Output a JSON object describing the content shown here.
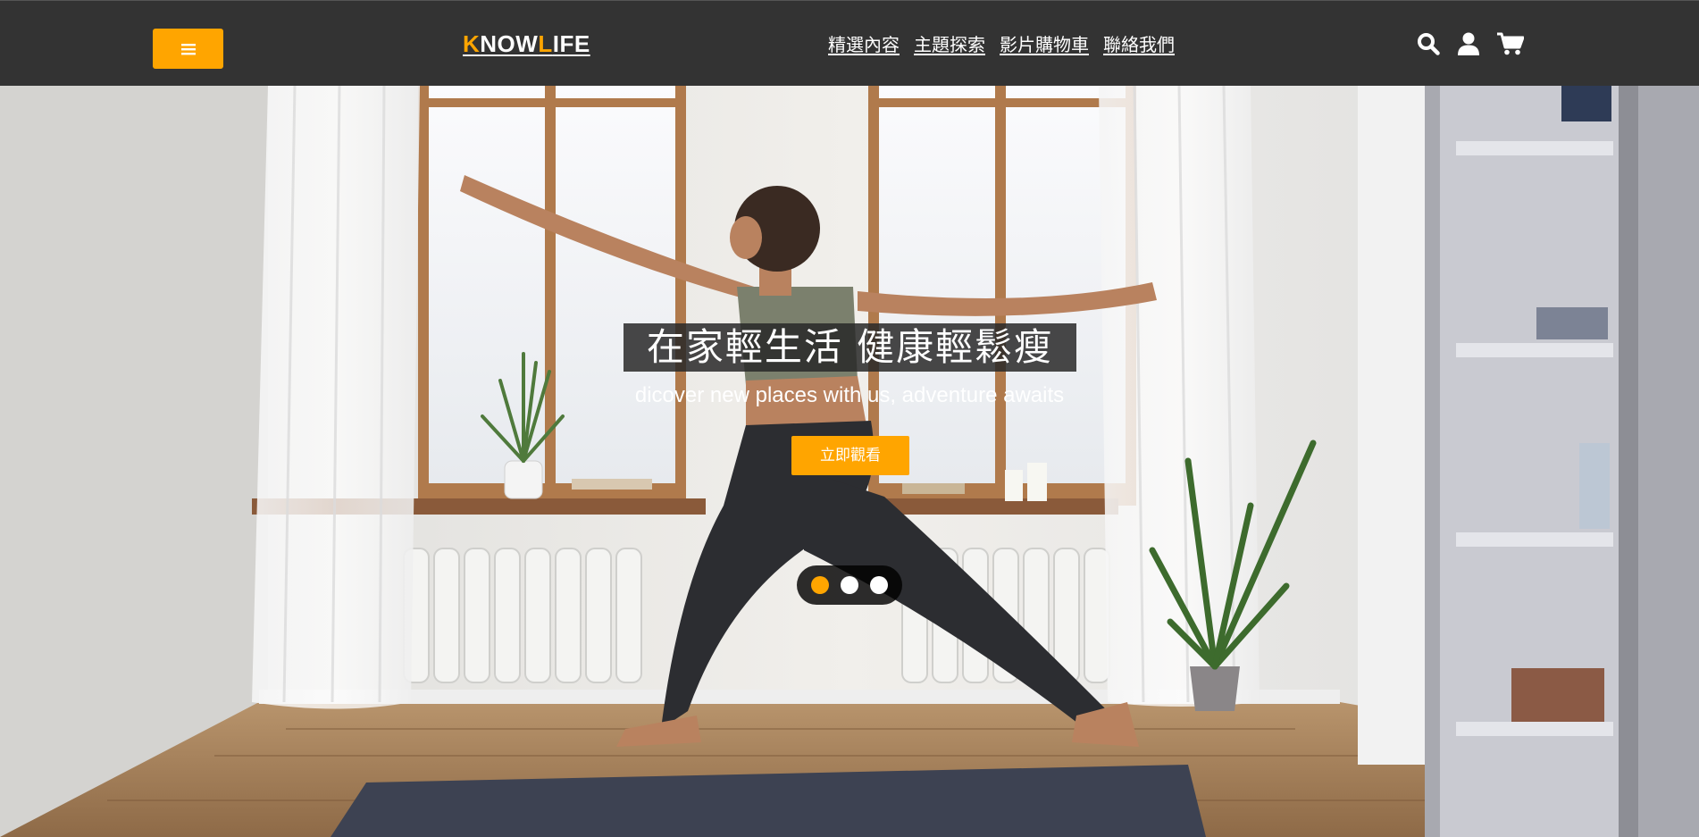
{
  "header": {
    "menu_icon": "hamburger-icon",
    "logo": {
      "k": "K",
      "now": "NOW",
      "l": "L",
      "ife": "IFE"
    },
    "nav": [
      {
        "label": "精選內容"
      },
      {
        "label": "主題探索"
      },
      {
        "label": "影片購物車"
      },
      {
        "label": "聯絡我們"
      }
    ],
    "icons": [
      "search-icon",
      "user-icon",
      "cart-icon"
    ]
  },
  "hero": {
    "title": "在家輕生活 健康輕鬆瘦",
    "subtitle": "dicover new places with us, adventure awaits",
    "cta_label": "立即觀看",
    "slides": 3,
    "active_slide": 1
  },
  "colors": {
    "accent": "#ffa500",
    "navbar": "#333333",
    "text_light": "#ffffff"
  }
}
